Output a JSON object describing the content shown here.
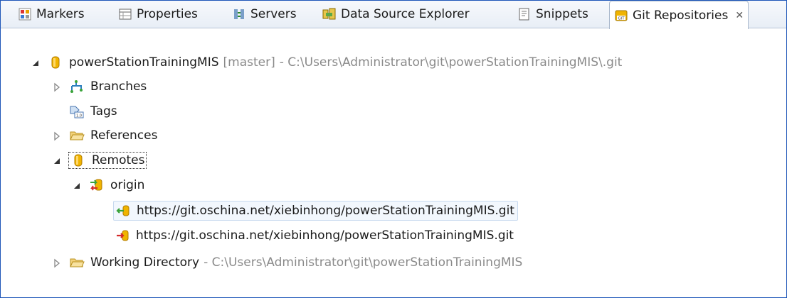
{
  "tabs": [
    {
      "label": "Markers",
      "icon": "markers-icon"
    },
    {
      "label": "Properties",
      "icon": "properties-icon"
    },
    {
      "label": "Servers",
      "icon": "servers-icon"
    },
    {
      "label": "Data Source Explorer",
      "icon": "data-source-explorer-icon"
    },
    {
      "label": "Snippets",
      "icon": "snippets-icon"
    },
    {
      "label": "Git Repositories",
      "icon": "git-repositories-icon",
      "close": "✕"
    }
  ],
  "tree": {
    "repo": {
      "name": "powerStationTrainingMIS",
      "branch": "[master]",
      "path": "- C:\\Users\\Administrator\\git\\powerStationTrainingMIS\\.git"
    },
    "branches": "Branches",
    "tags": "Tags",
    "references": "References",
    "remotes": "Remotes",
    "origin": "origin",
    "fetch_url": "https://git.oschina.net/xiebinhong/powerStationTrainingMIS.git",
    "push_url": "https://git.oschina.net/xiebinhong/powerStationTrainingMIS.git",
    "working_dir": {
      "label": "Working Directory",
      "path": "- C:\\Users\\Administrator\\git\\powerStationTrainingMIS"
    }
  },
  "colors": {
    "accent": "#1e56b8",
    "cylinder": "#f0b400",
    "fetch": "#3aa33a",
    "push": "#d42a2a"
  }
}
